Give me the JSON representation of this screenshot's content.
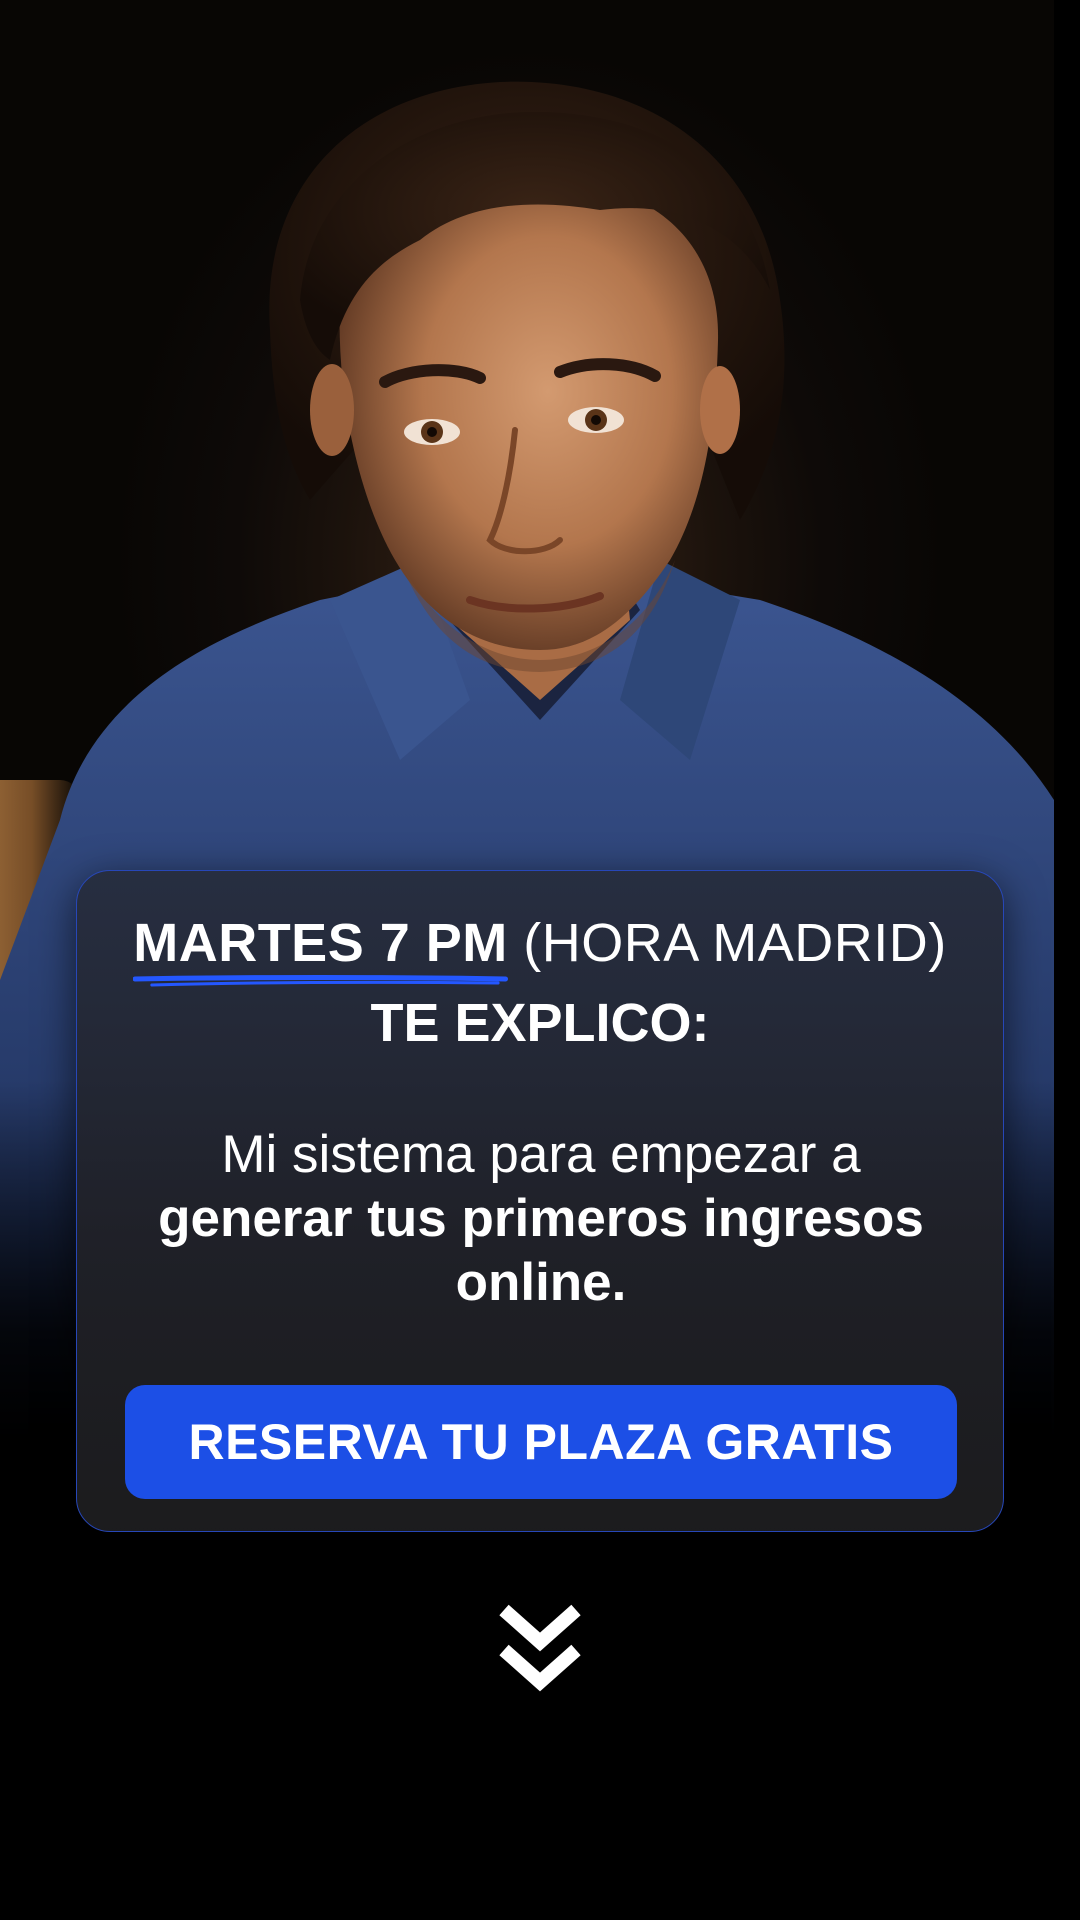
{
  "banner": {
    "date_time": "MARTES 7 PM",
    "timezone": "(HORA MADRID)",
    "intro": "TE EXPLICO:"
  },
  "pitch": {
    "lead": "Mi sistema para empezar a",
    "emphasis": "generar tus primeros ingresos online."
  },
  "cta": {
    "label": "RESERVA TU PLAZA GRATIS",
    "color": "#1c4fe6"
  },
  "icons": {
    "scroll_hint": "double-chevron-down-icon"
  },
  "colors": {
    "accent": "#1c4fe6",
    "underline": "#2457ff",
    "background": "#000000"
  }
}
